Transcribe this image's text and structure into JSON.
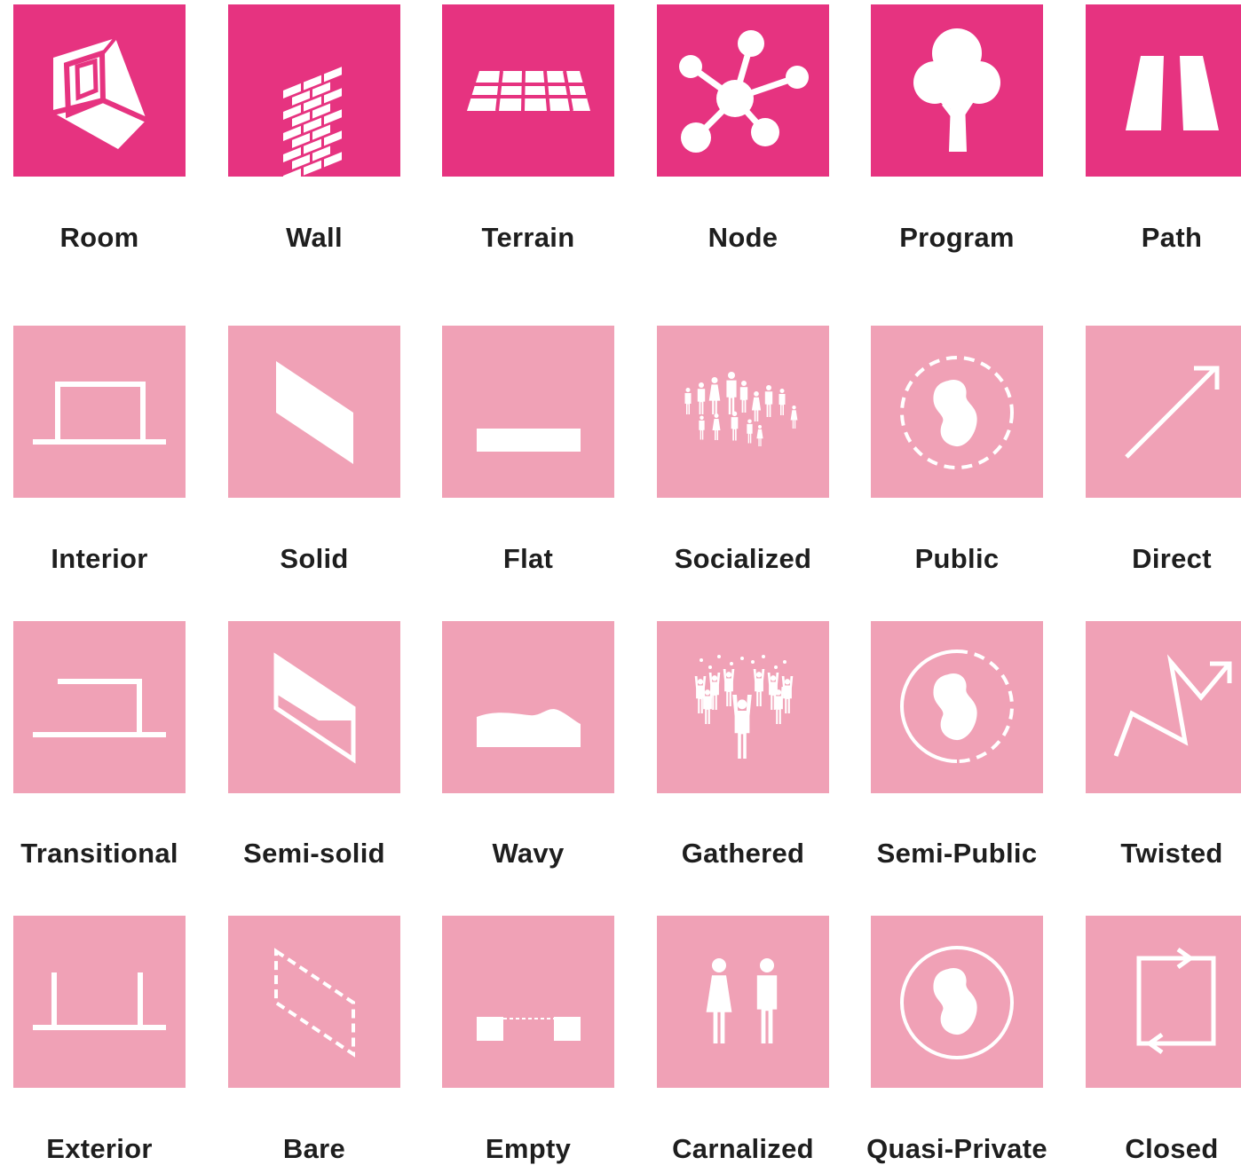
{
  "colors": {
    "category": "#e63380",
    "attribute": "#f0a1b6",
    "icon": "#ffffff",
    "text": "#1e1e1e"
  },
  "rows": [
    {
      "kind": "category",
      "items": [
        {
          "label": "Room",
          "icon": "isometric-room-cube-icon"
        },
        {
          "label": "Wall",
          "icon": "brick-wall-icon"
        },
        {
          "label": "Terrain",
          "icon": "terrain-grid-icon"
        },
        {
          "label": "Node",
          "icon": "network-node-icon"
        },
        {
          "label": "Program",
          "icon": "tree-icon"
        },
        {
          "label": "Path",
          "icon": "road-path-icon"
        }
      ]
    },
    {
      "kind": "attribute",
      "items": [
        {
          "label": "Interior",
          "icon": "interior-enclosure-icon"
        },
        {
          "label": "Solid",
          "icon": "solid-plane-icon"
        },
        {
          "label": "Flat",
          "icon": "flat-bar-icon"
        },
        {
          "label": "Socialized",
          "icon": "crowd-icon"
        },
        {
          "label": "Public",
          "icon": "public-dashed-circle-icon"
        },
        {
          "label": "Direct",
          "icon": "direct-arrow-icon"
        }
      ]
    },
    {
      "kind": "attribute",
      "items": [
        {
          "label": "Transitional",
          "icon": "transitional-enclosure-icon"
        },
        {
          "label": "Semi-solid",
          "icon": "semi-solid-plane-icon"
        },
        {
          "label": "Wavy",
          "icon": "wavy-bar-icon"
        },
        {
          "label": "Gathered",
          "icon": "celebrating-crowd-icon"
        },
        {
          "label": "Semi-Public",
          "icon": "semi-public-circle-icon"
        },
        {
          "label": "Twisted",
          "icon": "twisted-arrow-icon"
        }
      ]
    },
    {
      "kind": "attribute",
      "items": [
        {
          "label": "Exterior",
          "icon": "exterior-enclosure-icon"
        },
        {
          "label": "Bare",
          "icon": "bare-dashed-plane-icon"
        },
        {
          "label": "Empty",
          "icon": "empty-gap-icon"
        },
        {
          "label": "Carnalized",
          "icon": "couple-icon"
        },
        {
          "label": "Quasi-Private",
          "icon": "quasi-private-circle-icon"
        },
        {
          "label": "Closed",
          "icon": "closed-loop-icon"
        }
      ]
    }
  ]
}
